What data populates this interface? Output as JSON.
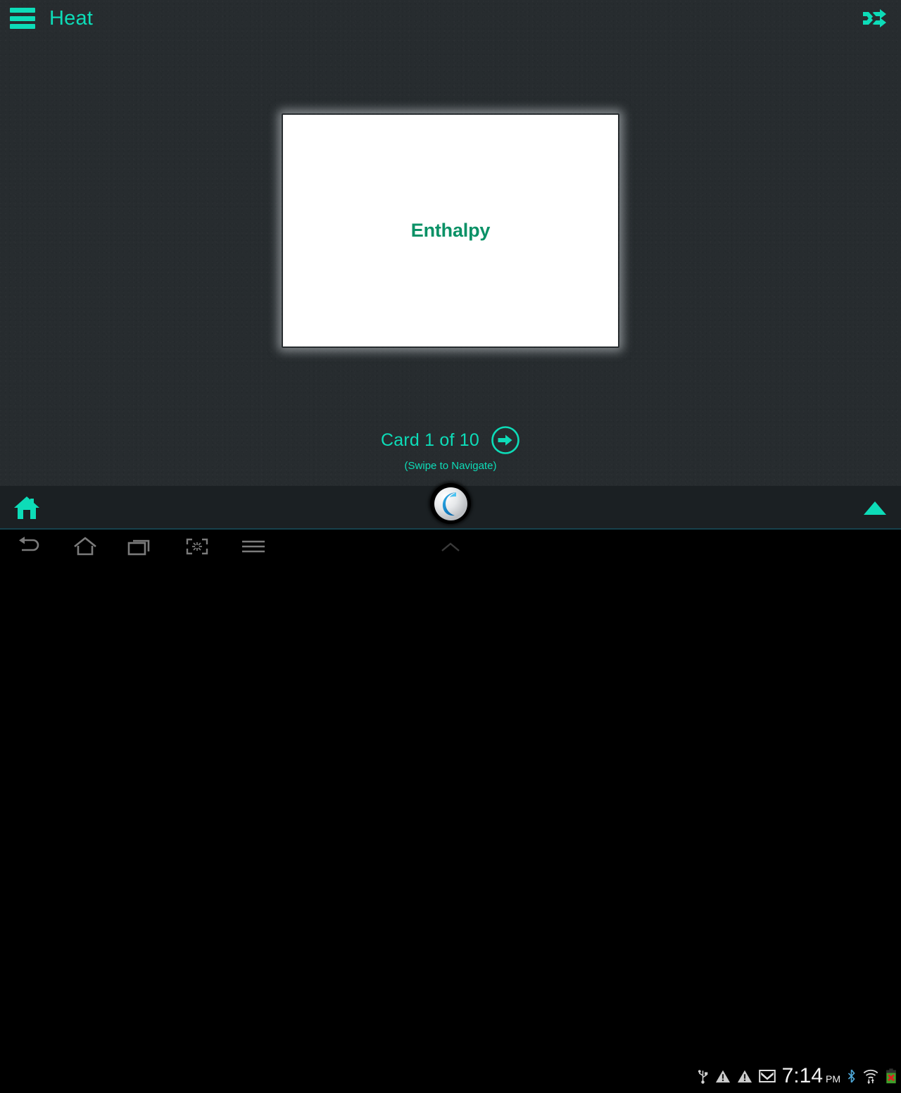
{
  "header": {
    "title": "Heat",
    "menu_icon": "hamburger-menu-icon",
    "shuffle_icon": "shuffle-icon",
    "accent_color": "#0ddcb8"
  },
  "card": {
    "term": "Enthalpy",
    "term_color": "#0a9166",
    "background_color": "#ffffff"
  },
  "navigation": {
    "counter": "Card 1 of 10",
    "current_card": 1,
    "total_cards": 10,
    "next_icon": "arrow-right-circle-icon",
    "hint": "(Swipe to Navigate)"
  },
  "app_bottom_bar": {
    "home_icon": "home-icon",
    "expand_icon": "triangle-up-icon",
    "logo_icon": "app-logo-crescent-icon",
    "background_color": "#1b2023"
  },
  "android_navbar": {
    "items": [
      {
        "name": "back-nav-icon",
        "label": "Back"
      },
      {
        "name": "home-nav-icon",
        "label": "Home"
      },
      {
        "name": "recents-nav-icon",
        "label": "Recent apps"
      },
      {
        "name": "capture-nav-icon",
        "label": "Screenshot"
      },
      {
        "name": "menu-nav-icon",
        "label": "Menu"
      }
    ],
    "chevron_icon": "chevron-up-icon"
  },
  "status_bar": {
    "time": "7:14",
    "ampm": "PM",
    "icons": [
      "usb-icon",
      "warning-triangle-icon",
      "warning-triangle-icon",
      "gmail-envelope-icon",
      "bluetooth-icon",
      "wifi-transfer-icon",
      "battery-error-icon"
    ]
  },
  "theme": {
    "app_background": "#272c2f",
    "accent": "#0ddcb8",
    "navbar_background": "#000000"
  }
}
